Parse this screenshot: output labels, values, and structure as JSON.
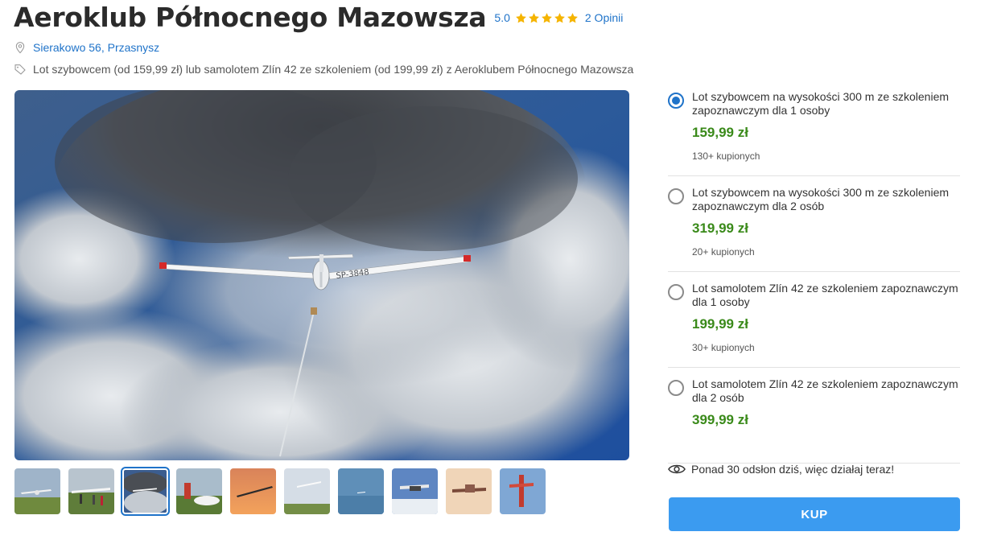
{
  "header": {
    "title": "Aeroklub Północnego Mazowsza",
    "rating_score": "5.0",
    "rating_stars": 5,
    "reviews_label": "2 Opinii",
    "location": "Sierakowo 56, Przasnysz",
    "description": "Lot szybowcem (od 159,99 zł) lub samolotem Zlín 42 ze szkoleniem (od 199,99 zł) z Aeroklubem Północnego Mazowsza"
  },
  "icons": {
    "location": "map-pin-icon",
    "tag": "price-tag-icon",
    "star": "star-icon",
    "eye": "eye-icon"
  },
  "gallery": {
    "selected_index": 2,
    "thumbnail_count": 10
  },
  "options": [
    {
      "name": "Lot szybowcem na wysokości 300 m ze szkoleniem zapoznawczym dla 1 osoby",
      "price": "159,99 zł",
      "sold": "130+ kupionych",
      "selected": true
    },
    {
      "name": "Lot szybowcem na wysokości 300 m ze szkoleniem zapoznawczym dla 2 osób",
      "price": "319,99 zł",
      "sold": "20+ kupionych",
      "selected": false
    },
    {
      "name": "Lot samolotem Zlín 42 ze szkoleniem zapoznawczym dla 1 osoby",
      "price": "199,99 zł",
      "sold": "30+ kupionych",
      "selected": false
    },
    {
      "name": "Lot samolotem Zlín 42 ze szkoleniem zapoznawczym dla 2 osób",
      "price": "399,99 zł",
      "sold": "",
      "selected": false
    }
  ],
  "urgency_text": "Ponad 30 odsłon dziś, więc działaj teraz!",
  "buy_label": "KUP",
  "colors": {
    "link": "#1f73c9",
    "price": "#3a8a1a",
    "star": "#f5b400",
    "button": "#3b9bf0"
  }
}
